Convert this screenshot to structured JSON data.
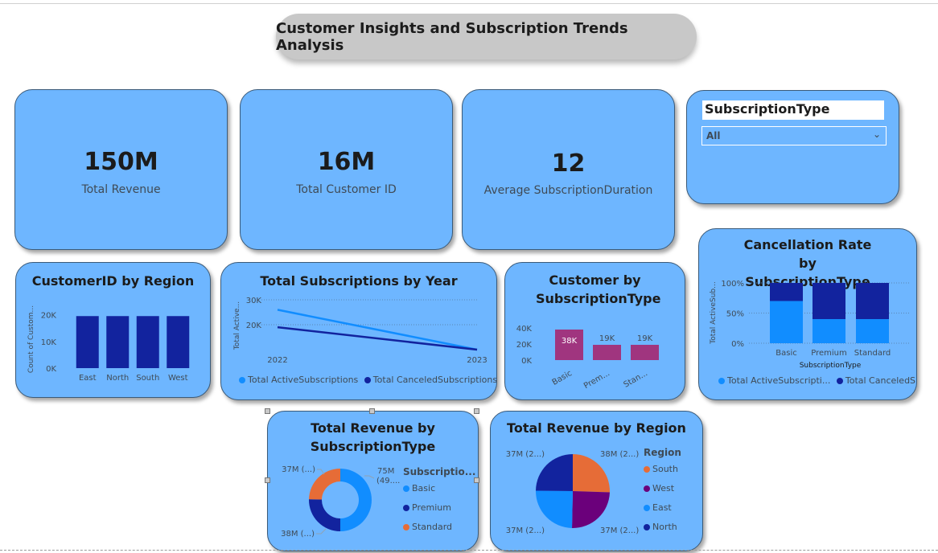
{
  "page_title": "Customer Insights and Subscription Trends Analysis",
  "kpis": [
    {
      "value": "150M",
      "label": "Total Revenue"
    },
    {
      "value": "16M",
      "label": "Total Customer ID"
    },
    {
      "value": "12",
      "label": "Average SubscriptionDuration"
    }
  ],
  "slicer": {
    "title": "SubscriptionType",
    "selected": "All"
  },
  "colors": {
    "card": "#6eb6ff",
    "light_blue": "#118dff",
    "navy": "#12239e",
    "magenta": "#a0357f",
    "orange": "#e66c37",
    "purple": "#6b007b"
  },
  "chart_data": [
    {
      "id": "customer_by_region",
      "type": "bar",
      "title": "CustomerID by Region",
      "ylabel": "Count of Custom...",
      "categories": [
        "East",
        "North",
        "South",
        "West"
      ],
      "values": [
        19500,
        19500,
        19500,
        19500
      ],
      "ylim": [
        0,
        25000
      ],
      "y_ticks": [
        "0K",
        "10K",
        "20K"
      ]
    },
    {
      "id": "subs_by_year",
      "type": "line",
      "title": "Total Subscriptions by Year",
      "ylabel": "Total Active...",
      "x": [
        "2022",
        "2023"
      ],
      "y_ticks": [
        "20K",
        "30K"
      ],
      "ylim": [
        10000,
        30000
      ],
      "series": [
        {
          "name": "Total ActiveSubscriptions",
          "values": [
            26000,
            10000
          ]
        },
        {
          "name": "Total CanceledSubscriptions",
          "values": [
            19000,
            10000
          ]
        }
      ]
    },
    {
      "id": "customer_by_type",
      "type": "bar",
      "title": "Customer by SubscriptionType",
      "categories": [
        "Basic",
        "Prem...",
        "Stan..."
      ],
      "values": [
        38000,
        19000,
        19000
      ],
      "data_labels": [
        "38K",
        "19K",
        "19K"
      ],
      "y_ticks": [
        "0K",
        "20K",
        "40K"
      ],
      "ylim": [
        0,
        40000
      ]
    },
    {
      "id": "cancel_rate",
      "type": "bar",
      "stacked": "100%",
      "title": "Cancellation Rate by SubscriptionType",
      "ylabel": "Total ActiveSub...",
      "xlabel": "SubscriptionType",
      "categories": [
        "Basic",
        "Premium",
        "Standard"
      ],
      "y_ticks": [
        "0%",
        "50%",
        "100%"
      ],
      "series": [
        {
          "name": "Total ActiveSubscripti...",
          "values": [
            0.7,
            0.4,
            0.4
          ]
        },
        {
          "name": "Total CanceledS...",
          "values": [
            0.3,
            0.6,
            0.6
          ]
        }
      ]
    },
    {
      "id": "revenue_by_type",
      "type": "pie",
      "donut": true,
      "title": "Total Revenue by SubscriptionType",
      "legend_title": "Subscriptio...",
      "categories": [
        "Basic",
        "Premium",
        "Standard"
      ],
      "values": [
        75,
        38,
        37
      ],
      "data_labels": [
        "75M (49....",
        "38M (...)",
        "37M (...)"
      ]
    },
    {
      "id": "revenue_by_region",
      "type": "pie",
      "title": "Total Revenue by Region",
      "legend_title": "Region",
      "categories": [
        "South",
        "West",
        "East",
        "North"
      ],
      "values": [
        38,
        37,
        37,
        37
      ],
      "data_labels": [
        "38M (2...)",
        "37M (2...)",
        "37M (2...)",
        "37M (2...)"
      ]
    }
  ]
}
